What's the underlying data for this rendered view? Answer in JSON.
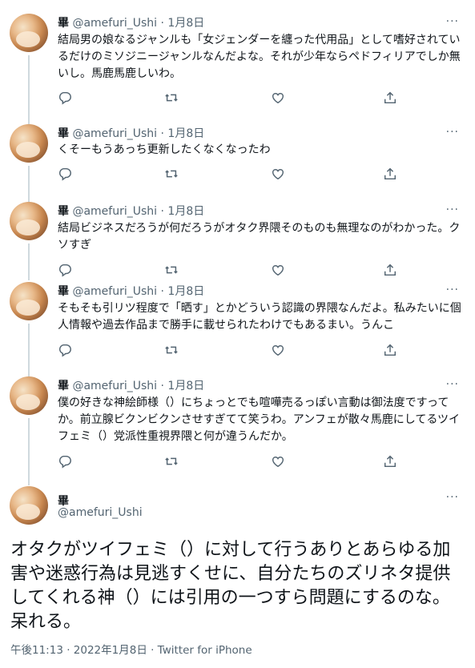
{
  "thread": [
    {
      "name": "畢",
      "handle": "@amefuri_Ushi",
      "separator": "·",
      "date": "1月8日",
      "text": "結局男の娘なるジャンルも「女ジェンダーを纏った代用品」として嗜好されているだけのミソジニージャンルなんだよな。それが少年ならペドフィリアでしか無いし。馬鹿馬鹿しいわ。"
    },
    {
      "name": "畢",
      "handle": "@amefuri_Ushi",
      "separator": "·",
      "date": "1月8日",
      "text": "くそーもうあっち更新したくなくなったわ"
    },
    {
      "name": "畢",
      "handle": "@amefuri_Ushi",
      "separator": "·",
      "date": "1月8日",
      "text": "結局ビジネスだろうが何だろうがオタク界隈そのものも無理なのがわかった。クソすぎ"
    },
    {
      "name": "畢",
      "handle": "@amefuri_Ushi",
      "separator": "·",
      "date": "1月8日",
      "text": "そもそも引リツ程度で「晒す」とかどういう認識の界隈なんだよ。私みたいに個人情報や過去作品まで勝手に載せられたわけでもあるまい。うんこ"
    },
    {
      "name": "畢",
      "handle": "@amefuri_Ushi",
      "separator": "·",
      "date": "1月8日",
      "text": "僕の好きな神絵師様（）にちょっとでも喧嘩売るっぽい言動は御法度ですってか。前立腺ビクンビクンさせすぎてて笑うわ。アンフェが散々馬鹿にしてるツイフェミ（）党派性重視界隈と何が違うんだか。"
    }
  ],
  "main_tweet": {
    "name": "畢",
    "handle": "@amefuri_Ushi",
    "text": "オタクがツイフェミ（）に対して行うありとあらゆる加害や迷惑行為は見逃すくせに、自分たちのズリネタ提供してくれる神（）には引用の一つすら問題にするのな。呆れる。",
    "meta": "午後11:13 · 2022年1月8日 · Twitter for iPhone"
  },
  "more_glyph": "···",
  "icons": [
    "reply-icon",
    "retweet-icon",
    "like-icon",
    "share-icon",
    "more-icon"
  ],
  "colors": {
    "text": "#0f1419",
    "secondary": "#536471",
    "thread_line": "#cfd9de"
  }
}
